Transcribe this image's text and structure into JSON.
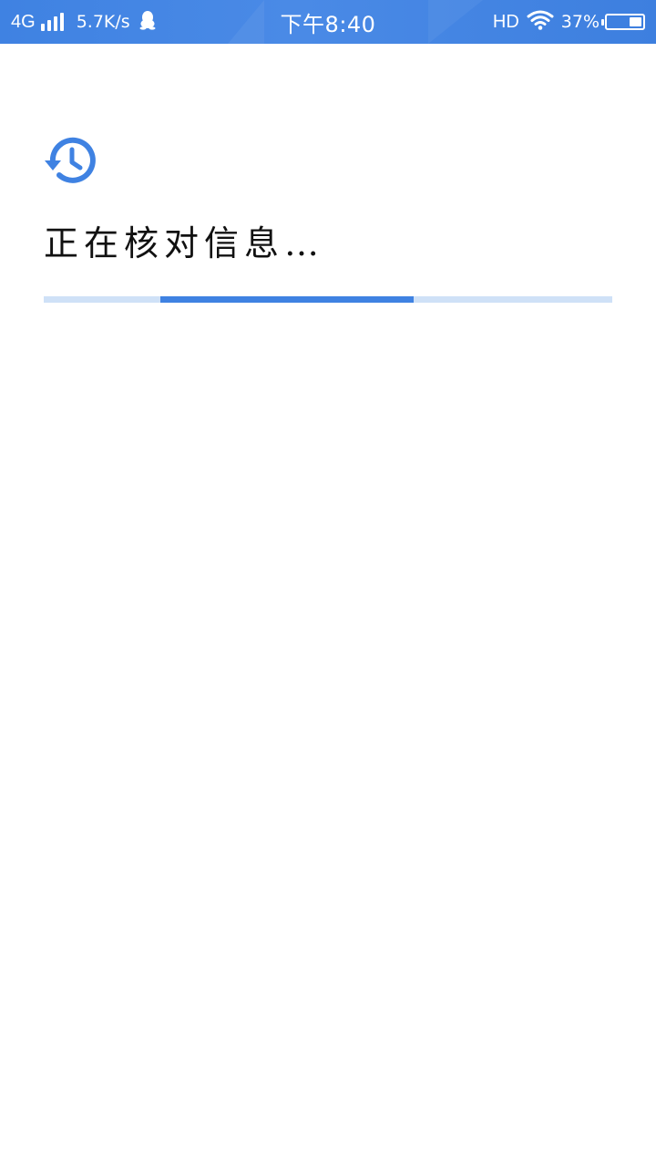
{
  "status_bar": {
    "network_type": "4G",
    "speed": "5.7K/s",
    "time": "下午8:40",
    "hd": "HD",
    "battery_percent": "37%",
    "battery_level": 0.37,
    "icons": [
      "signal-icon",
      "qq-penguin-icon",
      "wifi-icon",
      "battery-icon"
    ]
  },
  "main": {
    "icon": "history-icon",
    "heading": "正在核对信息…",
    "progress": {
      "segment_start": 0.205,
      "segment_end": 0.65
    }
  },
  "colors": {
    "accent": "#3f82e2",
    "track": "#cfe1f7",
    "status_bar": "#4a8ae6",
    "text": "#111111"
  }
}
